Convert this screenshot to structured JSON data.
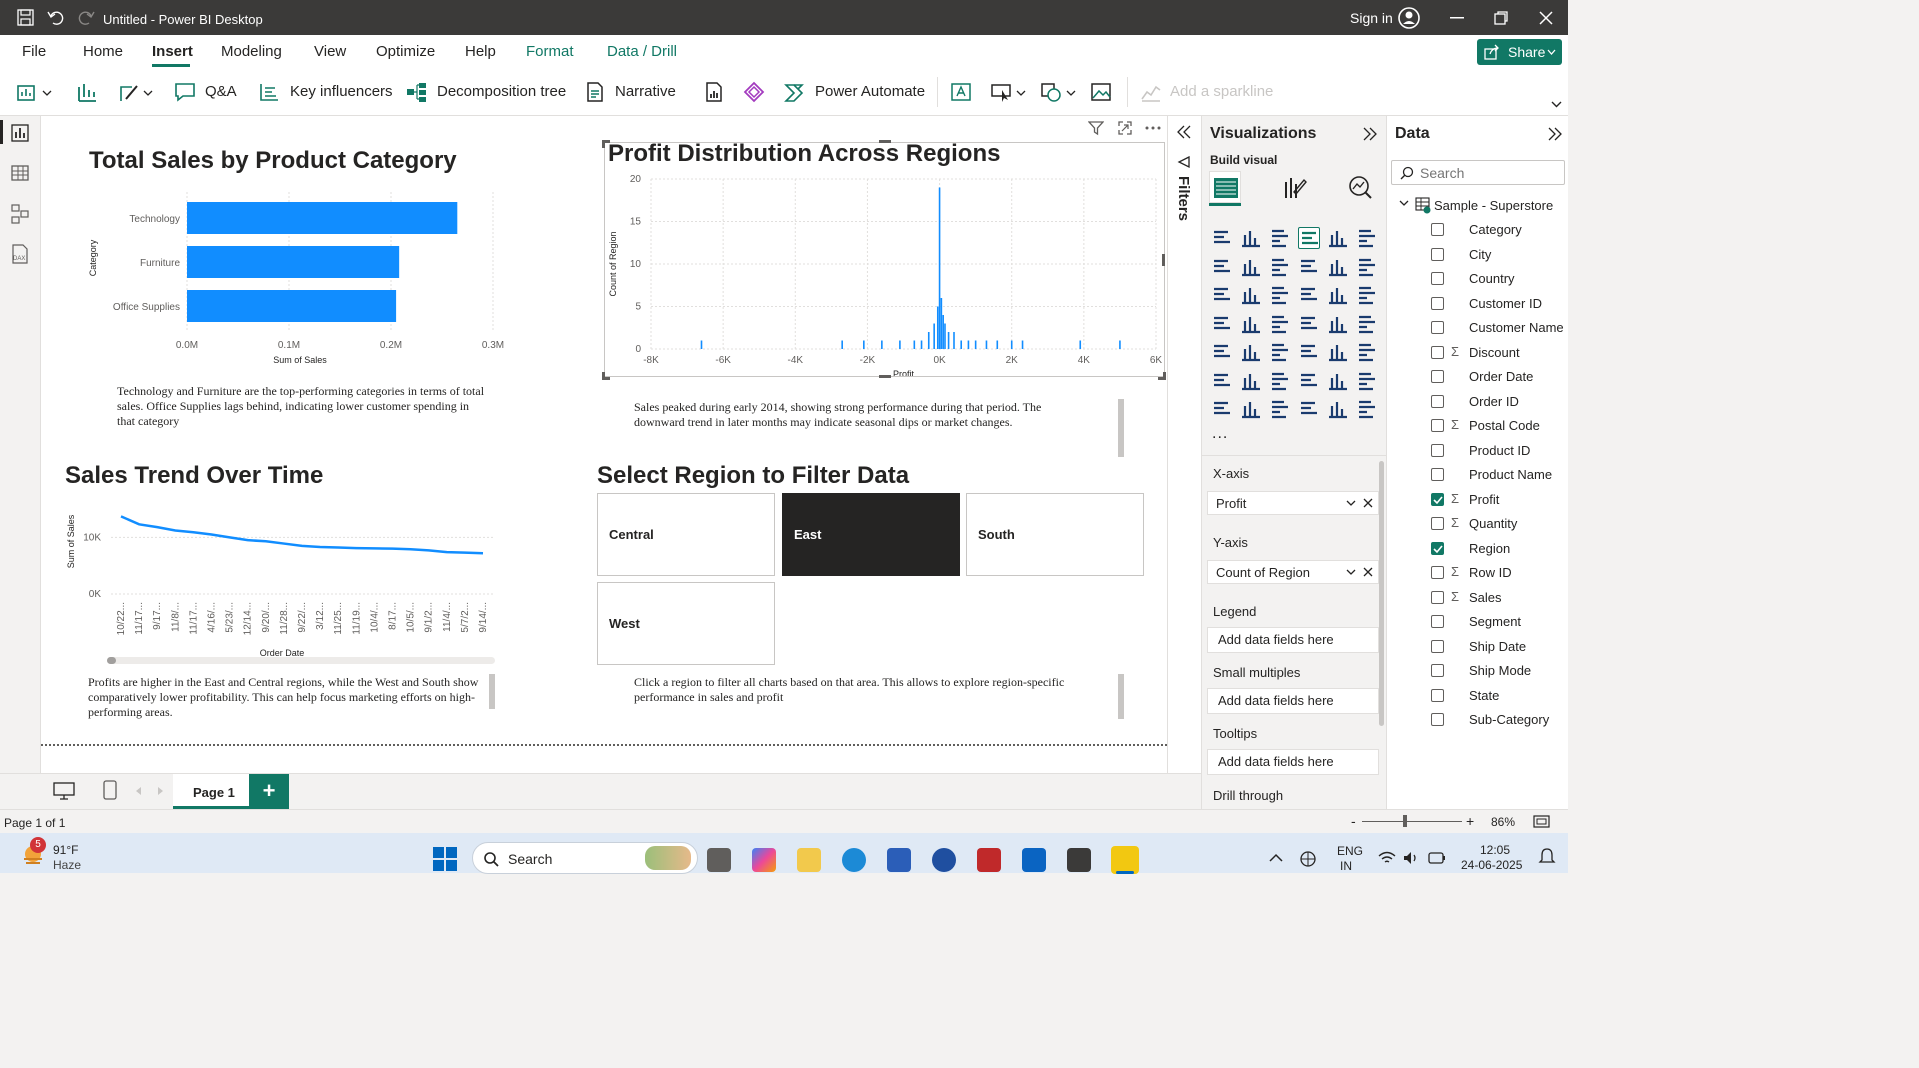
{
  "app": {
    "title": "Untitled - Power BI Desktop",
    "sign_in": "Sign in"
  },
  "menu": {
    "items": [
      "File",
      "Home",
      "Insert",
      "Modeling",
      "View",
      "Optimize",
      "Help",
      "Format",
      "Data / Drill"
    ],
    "share": "Share"
  },
  "ribbon": {
    "qa": "Q&A",
    "key_influencers": "Key influencers",
    "decomposition_tree": "Decomposition tree",
    "narrative": "Narrative",
    "power_automate": "Power Automate",
    "add_sparkline": "Add a sparkline"
  },
  "visuals": {
    "bar": {
      "title": "Total Sales by Product Category",
      "description": "Technology and Furniture are the top-performing categories in terms of total sales. Office Supplies lags behind, indicating lower customer spending in that category"
    },
    "hist": {
      "title": "Profit Distribution Across Regions",
      "description": "Sales peaked during early 2014, showing strong performance during that period. The downward trend in later months may indicate seasonal dips or market changes."
    },
    "line": {
      "title": "Sales Trend Over Time",
      "description": "Profits are higher in the East and Central regions, while the West and South show comparatively lower profitability. This can help focus marketing efforts on high-performing areas."
    },
    "slicer": {
      "title": "Select Region to Filter Data",
      "description": "Click a region to filter all charts based on that area. This allows  to explore region-specific performance in sales and profit",
      "options": [
        "Central",
        "East",
        "South",
        "West"
      ],
      "selected": "East"
    }
  },
  "chart_data": [
    {
      "type": "bar",
      "orientation": "horizontal",
      "categories": [
        "Technology",
        "Furniture",
        "Office Supplies"
      ],
      "values": [
        0.265,
        0.208,
        0.205
      ],
      "value_unit": "M",
      "xlabel": "Sum of Sales",
      "ylabel": "Category",
      "xticks": [
        "0.0M",
        "0.1M",
        "0.2M",
        "0.3M"
      ],
      "xlim": [
        0,
        0.3
      ],
      "grid": true
    },
    {
      "type": "bar",
      "subtype": "histogram",
      "x": [
        -6600,
        -2700,
        -2100,
        -1600,
        -1100,
        -700,
        -500,
        -300,
        -150,
        -50,
        0,
        50,
        100,
        150,
        250,
        400,
        600,
        800,
        1000,
        1300,
        1600,
        2000,
        2300,
        3900,
        5000
      ],
      "values": [
        1,
        1,
        1,
        1,
        1,
        1,
        1,
        2,
        3,
        5,
        19,
        6,
        4,
        3,
        2,
        2,
        1,
        1,
        1,
        1,
        1,
        1,
        1,
        1,
        1
      ],
      "xlabel": "Profit",
      "ylabel": "Count of Region",
      "xticks": [
        "-8K",
        "-6K",
        "-4K",
        "-2K",
        "0K",
        "2K",
        "4K",
        "6K"
      ],
      "yticks": [
        "0",
        "5",
        "10",
        "15",
        "20"
      ],
      "xlim": [
        -8000,
        6000
      ],
      "ylim": [
        0,
        20
      ],
      "grid": true
    },
    {
      "type": "line",
      "x": [
        "10/22...",
        "11/17...",
        "9/17...",
        "11/8/...",
        "11/17...",
        "4/16/...",
        "5/23/...",
        "12/14...",
        "9/20/...",
        "11/28...",
        "9/22/...",
        "3/12...",
        "11/25...",
        "11/19...",
        "10/4/...",
        "8/17...",
        "10/5/...",
        "9/1/2...",
        "11/4/...",
        "5/7/2...",
        "9/14/..."
      ],
      "values": [
        13700,
        12300,
        11800,
        11200,
        10900,
        10500,
        10000,
        9500,
        9300,
        8900,
        8500,
        8300,
        8200,
        8100,
        8050,
        8000,
        7900,
        7700,
        7400,
        7300,
        7200
      ],
      "xlabel": "Order Date",
      "ylabel": "Sum of Sales",
      "yticks": [
        "0K",
        "10K"
      ],
      "ylim": [
        0,
        15000
      ],
      "grid": true
    }
  ],
  "filters_label": "Filters",
  "vis_pane": {
    "title": "Visualizations",
    "build": "Build visual",
    "xaxis_label": "X-axis",
    "xaxis_value": "Profit",
    "yaxis_label": "Y-axis",
    "yaxis_value": "Count of Region",
    "legend_label": "Legend",
    "legend_value": "Add data fields here",
    "small_multiples_label": "Small multiples",
    "small_multiples_value": "Add data fields here",
    "tooltips_label": "Tooltips",
    "tooltips_value": "Add data fields here",
    "drill_label": "Drill through",
    "more": "..."
  },
  "data_pane": {
    "title": "Data",
    "search_placeholder": "Search",
    "table": "Sample - Superstore",
    "fields": [
      {
        "name": "Category",
        "sum": false,
        "checked": false
      },
      {
        "name": "City",
        "sum": false,
        "checked": false
      },
      {
        "name": "Country",
        "sum": false,
        "checked": false
      },
      {
        "name": "Customer ID",
        "sum": false,
        "checked": false
      },
      {
        "name": "Customer Name",
        "sum": false,
        "checked": false
      },
      {
        "name": "Discount",
        "sum": true,
        "checked": false
      },
      {
        "name": "Order Date",
        "sum": false,
        "checked": false
      },
      {
        "name": "Order ID",
        "sum": false,
        "checked": false
      },
      {
        "name": "Postal Code",
        "sum": true,
        "checked": false
      },
      {
        "name": "Product ID",
        "sum": false,
        "checked": false
      },
      {
        "name": "Product Name",
        "sum": false,
        "checked": false
      },
      {
        "name": "Profit",
        "sum": true,
        "checked": true
      },
      {
        "name": "Quantity",
        "sum": true,
        "checked": false
      },
      {
        "name": "Region",
        "sum": false,
        "checked": true
      },
      {
        "name": "Row ID",
        "sum": true,
        "checked": false
      },
      {
        "name": "Sales",
        "sum": true,
        "checked": false
      },
      {
        "name": "Segment",
        "sum": false,
        "checked": false
      },
      {
        "name": "Ship Date",
        "sum": false,
        "checked": false
      },
      {
        "name": "Ship Mode",
        "sum": false,
        "checked": false
      },
      {
        "name": "State",
        "sum": false,
        "checked": false
      },
      {
        "name": "Sub-Category",
        "sum": false,
        "checked": false
      }
    ]
  },
  "pages": {
    "tab": "Page 1",
    "add": "+"
  },
  "status": {
    "page": "Page 1 of 1",
    "zoom": "86%"
  },
  "taskbar": {
    "weather_temp": "91°F",
    "weather_desc": "Haze",
    "weather_badge": "5",
    "search": "Search",
    "lang1": "ENG",
    "lang2": "IN",
    "time": "12:05",
    "date": "24-06-2025"
  },
  "colors": {
    "accent": "#118dff",
    "green": "#117865",
    "dark": "#252423"
  }
}
